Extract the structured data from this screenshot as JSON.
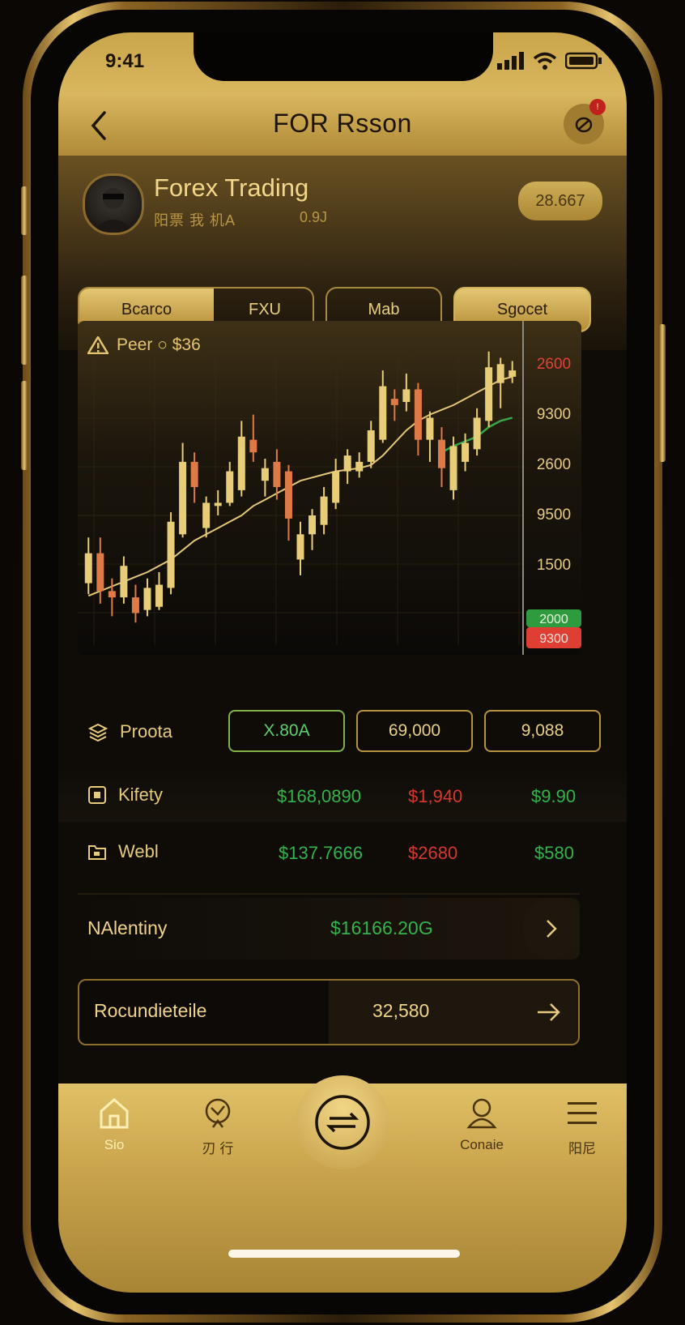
{
  "status_bar": {
    "time": "9:41"
  },
  "header": {
    "title": "FOR Rsson"
  },
  "profile": {
    "name": "Forex Trading",
    "subtitle": "阳票 我 机A",
    "subtitle2": "0.9J",
    "balance": "28.667"
  },
  "tabs": [
    {
      "label": "Bcarco",
      "active": true
    },
    {
      "label": "FXU",
      "active": false
    },
    {
      "label": "Mab",
      "active": false
    },
    {
      "label": "Sgocet",
      "active": true
    }
  ],
  "chart_data": {
    "type": "candlestick",
    "title": "Peer ○ $36",
    "y_tick_labels": [
      "2600",
      "9300",
      "2600",
      "9500",
      "1500"
    ],
    "price_tags": {
      "green": "2000",
      "red": "9300"
    },
    "colors": {
      "up": "#e7cd77",
      "down": "#df7a47",
      "ma_gold": "#e4c877",
      "ma_green": "#38a64a"
    },
    "candles": [
      {
        "o": 1545,
        "c": 1640,
        "h": 1690,
        "l": 1510,
        "up": true
      },
      {
        "o": 1640,
        "c": 1520,
        "h": 1690,
        "l": 1480,
        "up": false
      },
      {
        "o": 1520,
        "c": 1500,
        "h": 1560,
        "l": 1440,
        "up": false
      },
      {
        "o": 1500,
        "c": 1600,
        "h": 1630,
        "l": 1480,
        "up": true
      },
      {
        "o": 1500,
        "c": 1450,
        "h": 1540,
        "l": 1420,
        "up": false
      },
      {
        "o": 1460,
        "c": 1530,
        "h": 1560,
        "l": 1440,
        "up": true
      },
      {
        "o": 1470,
        "c": 1540,
        "h": 1580,
        "l": 1460,
        "up": true
      },
      {
        "o": 1530,
        "c": 1740,
        "h": 1770,
        "l": 1510,
        "up": true
      },
      {
        "o": 1700,
        "c": 1930,
        "h": 1990,
        "l": 1690,
        "up": true
      },
      {
        "o": 1930,
        "c": 1850,
        "h": 1960,
        "l": 1800,
        "up": false
      },
      {
        "o": 1720,
        "c": 1800,
        "h": 1820,
        "l": 1690,
        "up": true
      },
      {
        "o": 1800,
        "c": 1790,
        "h": 1840,
        "l": 1760,
        "up": true
      },
      {
        "o": 1800,
        "c": 1900,
        "h": 1930,
        "l": 1790,
        "up": true
      },
      {
        "o": 1840,
        "c": 2010,
        "h": 2060,
        "l": 1820,
        "up": true
      },
      {
        "o": 2000,
        "c": 1960,
        "h": 2080,
        "l": 1930,
        "up": false
      },
      {
        "o": 1870,
        "c": 1910,
        "h": 1940,
        "l": 1820,
        "up": true
      },
      {
        "o": 1930,
        "c": 1850,
        "h": 1970,
        "l": 1810,
        "up": false
      },
      {
        "o": 1900,
        "c": 1750,
        "h": 1920,
        "l": 1680,
        "up": false
      },
      {
        "o": 1620,
        "c": 1700,
        "h": 1740,
        "l": 1570,
        "up": true
      },
      {
        "o": 1700,
        "c": 1760,
        "h": 1780,
        "l": 1650,
        "up": true
      },
      {
        "o": 1730,
        "c": 1820,
        "h": 1850,
        "l": 1700,
        "up": true
      },
      {
        "o": 1800,
        "c": 1900,
        "h": 1940,
        "l": 1780,
        "up": true
      },
      {
        "o": 1900,
        "c": 1950,
        "h": 1970,
        "l": 1860,
        "up": true
      },
      {
        "o": 1900,
        "c": 1930,
        "h": 1960,
        "l": 1880,
        "up": true
      },
      {
        "o": 1930,
        "c": 2030,
        "h": 2060,
        "l": 1910,
        "up": true
      },
      {
        "o": 2000,
        "c": 2170,
        "h": 2220,
        "l": 1990,
        "up": true
      },
      {
        "o": 2130,
        "c": 2110,
        "h": 2160,
        "l": 2060,
        "up": false
      },
      {
        "o": 2120,
        "c": 2160,
        "h": 2210,
        "l": 2090,
        "up": true
      },
      {
        "o": 2160,
        "c": 2000,
        "h": 2180,
        "l": 1950,
        "up": false
      },
      {
        "o": 2000,
        "c": 2070,
        "h": 2090,
        "l": 1930,
        "up": true
      },
      {
        "o": 2000,
        "c": 1910,
        "h": 2040,
        "l": 1850,
        "up": false
      },
      {
        "o": 1840,
        "c": 1980,
        "h": 2010,
        "l": 1810,
        "up": true
      },
      {
        "o": 1930,
        "c": 1990,
        "h": 2020,
        "l": 1900,
        "up": true
      },
      {
        "o": 1970,
        "c": 2070,
        "h": 2100,
        "l": 1950,
        "up": true
      },
      {
        "o": 2060,
        "c": 2230,
        "h": 2280,
        "l": 2040,
        "up": true
      },
      {
        "o": 2180,
        "c": 2240,
        "h": 2260,
        "l": 2100,
        "up": true
      },
      {
        "o": 2200,
        "c": 2220,
        "h": 2250,
        "l": 2180,
        "up": true
      }
    ],
    "ma_gold": [
      1505,
      1520,
      1535,
      1550,
      1565,
      1580,
      1600,
      1620,
      1650,
      1680,
      1700,
      1720,
      1740,
      1760,
      1790,
      1810,
      1830,
      1850,
      1870,
      1880,
      1890,
      1900,
      1905,
      1910,
      1920,
      1950,
      1990,
      2030,
      2060,
      2080,
      2095,
      2110,
      2130,
      2150,
      2170,
      2190,
      2200
    ],
    "ma_green": [
      null,
      null,
      null,
      null,
      null,
      null,
      null,
      null,
      null,
      null,
      null,
      null,
      null,
      null,
      null,
      null,
      null,
      null,
      null,
      null,
      null,
      null,
      null,
      null,
      null,
      null,
      null,
      null,
      null,
      null,
      1960,
      1980,
      1995,
      2010,
      2040,
      2060,
      2070
    ]
  },
  "rows": [
    {
      "label": "Proota",
      "buttons": [
        "X.80A",
        "69,000",
        "9,088"
      ]
    },
    {
      "label": "Kifety",
      "values": [
        "$168,0890",
        "$1,940",
        "$9.90"
      ]
    },
    {
      "label": "Webl",
      "values": [
        "$137.7666",
        "$2680",
        "$580"
      ]
    }
  ],
  "summary": {
    "label": "NAlentiny",
    "value": "$16166.20G"
  },
  "action": {
    "label": "Rocundieteile",
    "value": "32,580"
  },
  "nav": [
    {
      "label": "Sio",
      "icon": "home-icon"
    },
    {
      "label": "刃 行",
      "icon": "gift-icon"
    },
    {
      "label": "",
      "icon": "trade-icon"
    },
    {
      "label": "Conaie",
      "icon": "user-icon"
    },
    {
      "label": "阳尼",
      "icon": "menu-icon"
    }
  ]
}
